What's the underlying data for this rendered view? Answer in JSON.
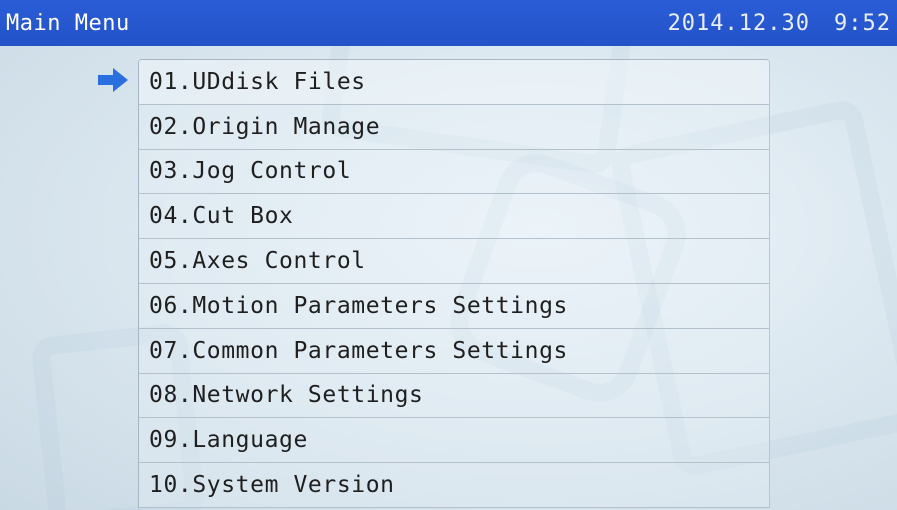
{
  "title_bar": {
    "title": "Main Menu",
    "date": "2014.12.30",
    "time": "9:52"
  },
  "selected_index": 0,
  "selection_icon": "right-arrow-icon",
  "colors": {
    "title_bar": "#2352c9",
    "title_text": "#ffffff",
    "arrow": "#2a6fe0",
    "item_text": "#1f1f1f"
  },
  "menu": {
    "items": [
      {
        "label": "01.UDdisk Files"
      },
      {
        "label": "02.Origin Manage"
      },
      {
        "label": "03.Jog Control"
      },
      {
        "label": "04.Cut Box"
      },
      {
        "label": "05.Axes Control"
      },
      {
        "label": "06.Motion Parameters Settings"
      },
      {
        "label": "07.Common Parameters Settings"
      },
      {
        "label": "08.Network Settings"
      },
      {
        "label": "09.Language"
      },
      {
        "label": "10.System Version"
      }
    ]
  }
}
